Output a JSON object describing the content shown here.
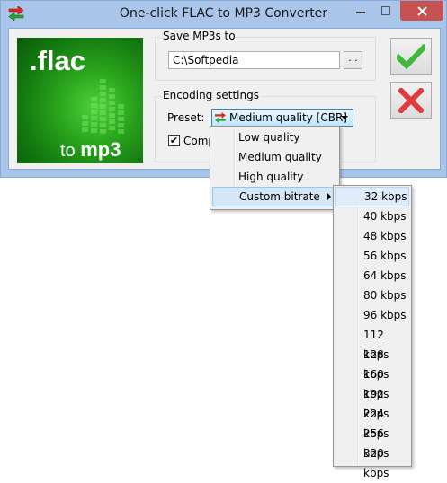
{
  "window": {
    "title": "One-click FLAC to MP3 Converter",
    "minimize_icon": "minimize-icon",
    "maximize_icon": "maximize-icon",
    "close_icon": "close-icon"
  },
  "logo": {
    "flac_text": ".flac",
    "to_text": "to",
    "mp3_text": "mp3"
  },
  "save": {
    "group_label": "Save MP3s to",
    "path_value": "C:\\Softpedia",
    "browse_label": "..."
  },
  "encoding": {
    "group_label": "Encoding settings",
    "preset_label": "Preset:",
    "preset_value": "Medium quality [CBR]",
    "comp_label": "Comp",
    "comp_checked": true
  },
  "buttons": {
    "ok_icon": "checkmark-icon",
    "cancel_icon": "x-icon"
  },
  "preset_menu": {
    "items": [
      "Low quality",
      "Medium quality",
      "High quality",
      "Custom bitrate"
    ],
    "selected_index": 3
  },
  "bitrate_menu": {
    "items": [
      "32 kbps",
      "40 kbps",
      "48 kbps",
      "56 kbps",
      "64 kbps",
      "80 kbps",
      "96 kbps",
      "112 kbps",
      "128 kbps",
      "160 kbps",
      "192 kbps",
      "224 kbps",
      "256 kbps",
      "320 kbps"
    ]
  },
  "colors": {
    "title_bar": "#a9c6ea",
    "close_button": "#c75050",
    "logo_green": "#2aa51c",
    "ok_green": "#3fb93a",
    "cancel_red": "#e03a3a",
    "selection": "#d5e6f7"
  }
}
